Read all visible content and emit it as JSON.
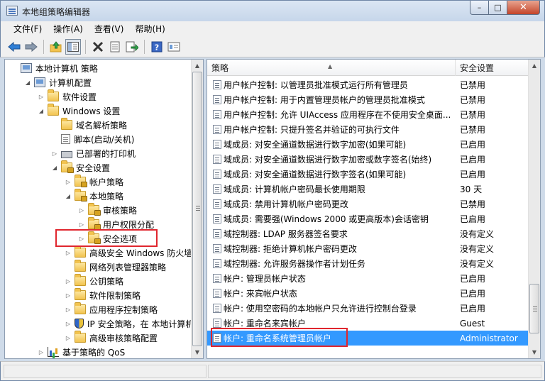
{
  "window": {
    "title": "本地组策略编辑器",
    "controls": {
      "minimize": "–",
      "maximize": "□",
      "close": "✕"
    }
  },
  "menu": [
    "文件(F)",
    "操作(A)",
    "查看(V)",
    "帮助(H)"
  ],
  "toolbar_icons": [
    "back-arrow-icon",
    "forward-arrow-icon",
    "up-folder-icon",
    "show-tree-icon",
    "delete-icon",
    "properties-icon",
    "export-list-icon",
    "help-icon",
    "view-icon"
  ],
  "tree": [
    {
      "label": "本地计算机 策略",
      "level": 0,
      "twisty": "",
      "icon": "computer"
    },
    {
      "label": "计算机配置",
      "level": 1,
      "twisty": "◢",
      "icon": "computer"
    },
    {
      "label": "软件设置",
      "level": 2,
      "twisty": "▷",
      "icon": "folder"
    },
    {
      "label": "Windows 设置",
      "level": 2,
      "twisty": "◢",
      "icon": "folder"
    },
    {
      "label": "域名解析策略",
      "level": 3,
      "twisty": "",
      "icon": "folder"
    },
    {
      "label": "脚本(启动/关机)",
      "level": 3,
      "twisty": "",
      "icon": "doc"
    },
    {
      "label": "已部署的打印机",
      "level": 3,
      "twisty": "▷",
      "icon": "printer"
    },
    {
      "label": "安全设置",
      "level": 3,
      "twisty": "◢",
      "icon": "folder-lock"
    },
    {
      "label": "帐户策略",
      "level": 4,
      "twisty": "▷",
      "icon": "folder-lock"
    },
    {
      "label": "本地策略",
      "level": 4,
      "twisty": "◢",
      "icon": "folder-lock"
    },
    {
      "label": "审核策略",
      "level": 5,
      "twisty": "▷",
      "icon": "folder-lock"
    },
    {
      "label": "用户权限分配",
      "level": 5,
      "twisty": "▷",
      "icon": "folder-lock"
    },
    {
      "label": "安全选项",
      "level": 5,
      "twisty": "▷",
      "icon": "folder-lock"
    },
    {
      "label": "高级安全 Windows 防火墙",
      "level": 4,
      "twisty": "▷",
      "icon": "folder"
    },
    {
      "label": "网络列表管理器策略",
      "level": 4,
      "twisty": "",
      "icon": "folder"
    },
    {
      "label": "公钥策略",
      "level": 4,
      "twisty": "▷",
      "icon": "folder"
    },
    {
      "label": "软件限制策略",
      "level": 4,
      "twisty": "▷",
      "icon": "folder"
    },
    {
      "label": "应用程序控制策略",
      "level": 4,
      "twisty": "▷",
      "icon": "folder"
    },
    {
      "label": "IP 安全策略，在 本地计算机",
      "level": 4,
      "twisty": "▷",
      "icon": "shield"
    },
    {
      "label": "高级审核策略配置",
      "level": 4,
      "twisty": "▷",
      "icon": "folder"
    },
    {
      "label": "基于策略的 QoS",
      "level": 2,
      "twisty": "▷",
      "icon": "chart"
    }
  ],
  "list": {
    "columns": {
      "policy": "策略",
      "setting": "安全设置"
    },
    "rows": [
      {
        "policy": "用户帐户控制: 以管理员批准模式运行所有管理员",
        "setting": "已禁用"
      },
      {
        "policy": "用户帐户控制: 用于内置管理员帐户的管理员批准模式",
        "setting": "已禁用"
      },
      {
        "policy": "用户帐户控制: 允许 UIAccess 应用程序在不使用安全桌面...",
        "setting": "已禁用"
      },
      {
        "policy": "用户帐户控制: 只提升签名并验证的可执行文件",
        "setting": "已禁用"
      },
      {
        "policy": "域成员: 对安全通道数据进行数字加密(如果可能)",
        "setting": "已启用"
      },
      {
        "policy": "域成员: 对安全通道数据进行数字加密或数字签名(始终)",
        "setting": "已启用"
      },
      {
        "policy": "域成员: 对安全通道数据进行数字签名(如果可能)",
        "setting": "已启用"
      },
      {
        "policy": "域成员: 计算机帐户密码最长使用期限",
        "setting": "30 天"
      },
      {
        "policy": "域成员: 禁用计算机帐户密码更改",
        "setting": "已禁用"
      },
      {
        "policy": "域成员: 需要强(Windows 2000 或更高版本)会话密钥",
        "setting": "已启用"
      },
      {
        "policy": "域控制器: LDAP 服务器签名要求",
        "setting": "没有定义"
      },
      {
        "policy": "域控制器: 拒绝计算机帐户密码更改",
        "setting": "没有定义"
      },
      {
        "policy": "域控制器: 允许服务器操作者计划任务",
        "setting": "没有定义"
      },
      {
        "policy": "帐户: 管理员帐户状态",
        "setting": "已启用"
      },
      {
        "policy": "帐户: 来宾帐户状态",
        "setting": "已启用"
      },
      {
        "policy": "帐户: 使用空密码的本地帐户只允许进行控制台登录",
        "setting": "已启用"
      },
      {
        "policy": "帐户: 重命名来宾帐户",
        "setting": "Guest"
      },
      {
        "policy": "帐户: 重命名系统管理员帐户",
        "setting": "Administrator"
      }
    ],
    "selected_index": 17
  },
  "colors": {
    "selection": "#3399ff",
    "highlight_box": "#e0262e",
    "window_frame": "#cfdbe9"
  }
}
